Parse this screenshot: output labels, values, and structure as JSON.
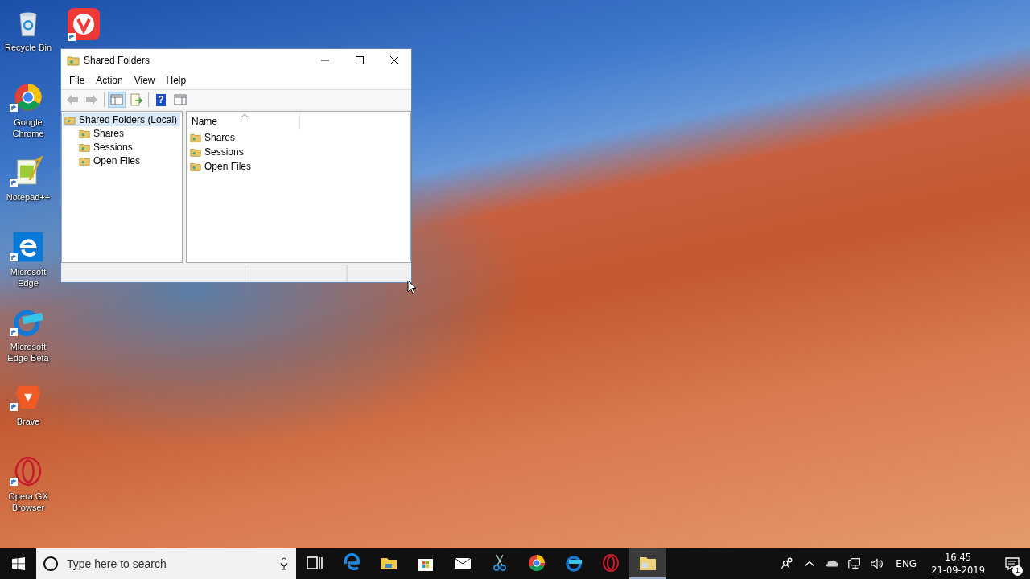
{
  "desktop_icons": [
    {
      "kind": "recycle",
      "label": "Recycle Bin",
      "shortcut": false
    },
    {
      "kind": "chrome",
      "label": "Google Chrome",
      "shortcut": true
    },
    {
      "kind": "notepad",
      "label": "Notepad++",
      "shortcut": true
    },
    {
      "kind": "edge",
      "label": "Microsoft Edge",
      "shortcut": true
    },
    {
      "kind": "edge-beta",
      "label": "Microsoft Edge Beta",
      "shortcut": true
    },
    {
      "kind": "brave",
      "label": "Brave",
      "shortcut": true
    },
    {
      "kind": "opera",
      "label": "Opera GX Browser",
      "shortcut": true
    }
  ],
  "vivaldi_icon": {
    "kind": "vivaldi",
    "shortcut": true
  },
  "window": {
    "title": "Shared Folders",
    "menu": [
      "File",
      "Action",
      "View",
      "Help"
    ],
    "toolbar": [
      {
        "kind": "back",
        "disabled": true
      },
      {
        "kind": "forward",
        "disabled": true
      },
      {
        "kind": "tree-toggle",
        "disabled": false,
        "selected": true
      },
      {
        "kind": "export",
        "disabled": false,
        "selected": false
      },
      {
        "kind": "help",
        "label": "?",
        "disabled": false,
        "selected": false
      },
      {
        "kind": "properties",
        "disabled": false,
        "selected": false
      }
    ],
    "tree": {
      "label": "Shared Folders (Local)",
      "selected": true,
      "children": [
        {
          "label": "Shares",
          "selected": false
        },
        {
          "label": "Sessions",
          "selected": false
        },
        {
          "label": "Open Files",
          "selected": false
        }
      ]
    },
    "list": {
      "columns": [
        "Name"
      ],
      "rows": [
        "Shares",
        "Sessions",
        "Open Files"
      ]
    }
  },
  "taskbar": {
    "search_placeholder": "Type here to search",
    "apps": [
      {
        "kind": "task-view",
        "active": false
      },
      {
        "kind": "edge",
        "active": false
      },
      {
        "kind": "explorer",
        "active": false
      },
      {
        "kind": "store",
        "active": false
      },
      {
        "kind": "mail",
        "active": false
      },
      {
        "kind": "snip",
        "active": false
      },
      {
        "kind": "chrome",
        "active": false
      },
      {
        "kind": "edge-beta",
        "active": false
      },
      {
        "kind": "opera",
        "active": false
      },
      {
        "kind": "explorer-mmc",
        "active": true
      }
    ],
    "language": "ENG",
    "time": "16:45",
    "date": "21-09-2019",
    "notification_count": "1"
  }
}
